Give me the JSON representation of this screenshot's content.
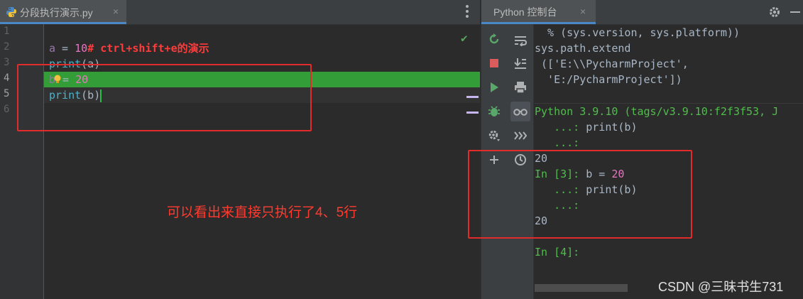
{
  "editor": {
    "tab": {
      "label": "分段执行演示.py",
      "close": "×"
    },
    "line_numbers": [
      "1",
      "2",
      "3",
      "4",
      "5",
      "6"
    ],
    "code": {
      "l1_comment": "# ctrl+shift+e的演示",
      "l2_var": "a",
      "l2_eq": " = ",
      "l2_num": "10",
      "l3_fn": "print",
      "l3_rest": "(a)",
      "l4_var": "b",
      "l4_eq": "= ",
      "l4_num": "20",
      "l5_fn": "print",
      "l5_rest": "(b)"
    }
  },
  "annotation": "可以看出来直接只执行了4、5行",
  "console": {
    "tab": {
      "label": "Python 控制台",
      "close": "×"
    },
    "output": {
      "o1": "  % (sys.version, sys.platform))",
      "o2": "sys.path.extend",
      "o3": " (['E:\\\\PycharmProject',",
      "o4": "  'E:/PycharmProject'])",
      "o5": "Python 3.9.10 (tags/v3.9.10:f2f3f53, J",
      "o6_prompt": "   ...: ",
      "o6_code": "print(b)",
      "o7": "   ...:",
      "o8": "20",
      "o9_prompt": "In [3]: ",
      "o9_var": "b = ",
      "o9_num": "20",
      "o10_prompt": "   ...: ",
      "o10_code": "print(b)",
      "o11": "   ...:",
      "o12": "20",
      "o13": "In [4]:"
    }
  },
  "watermark": "CSDN @三昧书生731",
  "colors": {
    "accent": "#4a88c7",
    "highlight_green": "#339d37",
    "annotation_red": "#e22b2b",
    "prompt_green": "#50bd4c",
    "number_pink": "#e776c0"
  },
  "icons": {
    "editor": [
      "python-file-icon",
      "close-icon",
      "more-vert-icon",
      "check-icon",
      "lightbulb-icon"
    ],
    "console_left": [
      "rerun-icon",
      "stop-icon",
      "run-icon",
      "debug-icon",
      "settings-icon",
      "add-icon"
    ],
    "console_right": [
      "soft-wrap-icon",
      "scroll-to-end-icon",
      "print-icon",
      "show-variables-icon",
      "execute-icon",
      "history-icon"
    ]
  }
}
